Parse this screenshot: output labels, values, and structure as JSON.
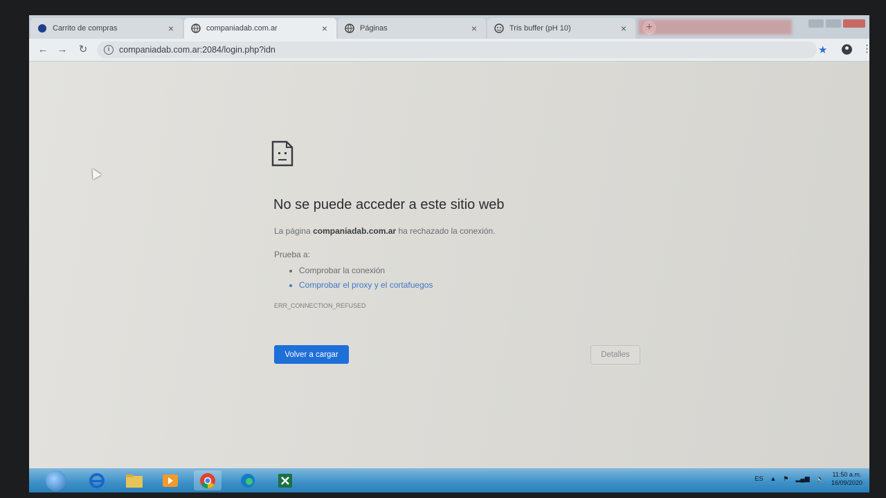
{
  "browser": {
    "tabs": [
      {
        "title": "Carrito de compras",
        "active": false
      },
      {
        "title": "companiadab.com.ar",
        "active": true
      },
      {
        "title": "Páginas",
        "active": false
      },
      {
        "title": "Tris buffer (pH 10)",
        "active": false
      }
    ],
    "close_glyph": "×",
    "new_tab_glyph": "+",
    "url": "companiadab.com.ar:2084/login.php?idn"
  },
  "error_page": {
    "title": "No se puede acceder a este sitio web",
    "desc_prefix": "La página ",
    "desc_domain": "companiadab.com.ar",
    "desc_suffix": " ha rechazado la conexión.",
    "try_label": "Prueba a:",
    "suggestions": [
      "Comprobar la conexión",
      "Comprobar el proxy y el cortafuegos"
    ],
    "error_code": "ERR_CONNECTION_REFUSED",
    "reload_label": "Volver a cargar",
    "details_label": "Detalles"
  },
  "taskbar": {
    "language": "ES",
    "time": "11:50 a.m.",
    "date": "16/09/2020"
  },
  "colors": {
    "accent": "#1e6fd8",
    "link": "#3f77c4",
    "taskbar": "#3f93c9"
  }
}
